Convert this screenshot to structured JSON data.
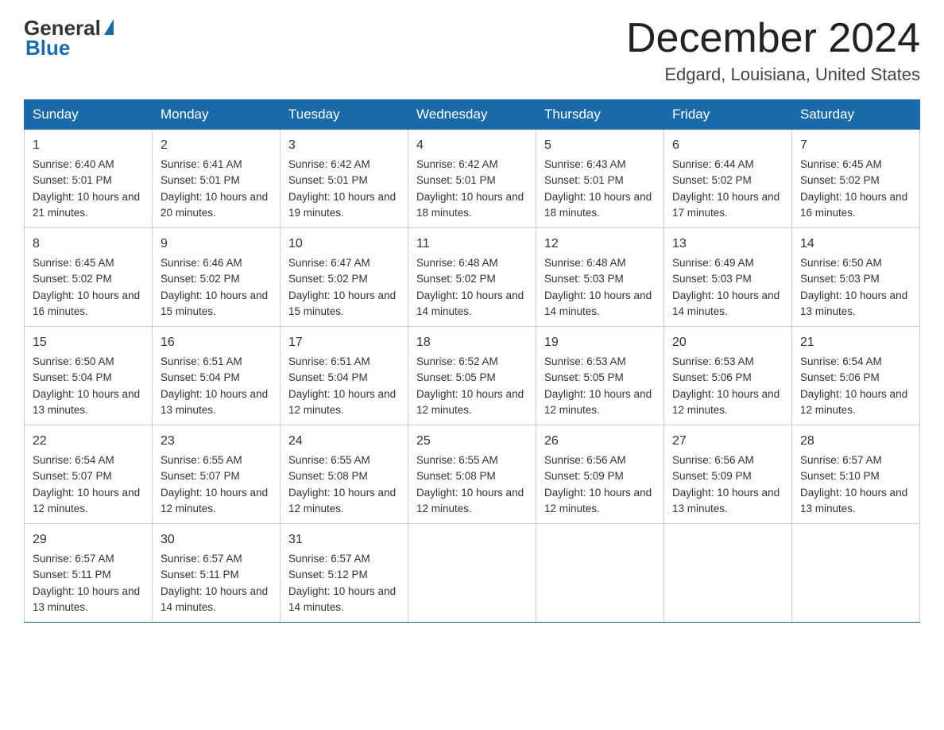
{
  "header": {
    "logo_general": "General",
    "logo_blue": "Blue",
    "month_title": "December 2024",
    "location": "Edgard, Louisiana, United States"
  },
  "days_of_week": [
    "Sunday",
    "Monday",
    "Tuesday",
    "Wednesday",
    "Thursday",
    "Friday",
    "Saturday"
  ],
  "weeks": [
    [
      {
        "day": "1",
        "sunrise": "6:40 AM",
        "sunset": "5:01 PM",
        "daylight": "10 hours and 21 minutes."
      },
      {
        "day": "2",
        "sunrise": "6:41 AM",
        "sunset": "5:01 PM",
        "daylight": "10 hours and 20 minutes."
      },
      {
        "day": "3",
        "sunrise": "6:42 AM",
        "sunset": "5:01 PM",
        "daylight": "10 hours and 19 minutes."
      },
      {
        "day": "4",
        "sunrise": "6:42 AM",
        "sunset": "5:01 PM",
        "daylight": "10 hours and 18 minutes."
      },
      {
        "day": "5",
        "sunrise": "6:43 AM",
        "sunset": "5:01 PM",
        "daylight": "10 hours and 18 minutes."
      },
      {
        "day": "6",
        "sunrise": "6:44 AM",
        "sunset": "5:02 PM",
        "daylight": "10 hours and 17 minutes."
      },
      {
        "day": "7",
        "sunrise": "6:45 AM",
        "sunset": "5:02 PM",
        "daylight": "10 hours and 16 minutes."
      }
    ],
    [
      {
        "day": "8",
        "sunrise": "6:45 AM",
        "sunset": "5:02 PM",
        "daylight": "10 hours and 16 minutes."
      },
      {
        "day": "9",
        "sunrise": "6:46 AM",
        "sunset": "5:02 PM",
        "daylight": "10 hours and 15 minutes."
      },
      {
        "day": "10",
        "sunrise": "6:47 AM",
        "sunset": "5:02 PM",
        "daylight": "10 hours and 15 minutes."
      },
      {
        "day": "11",
        "sunrise": "6:48 AM",
        "sunset": "5:02 PM",
        "daylight": "10 hours and 14 minutes."
      },
      {
        "day": "12",
        "sunrise": "6:48 AM",
        "sunset": "5:03 PM",
        "daylight": "10 hours and 14 minutes."
      },
      {
        "day": "13",
        "sunrise": "6:49 AM",
        "sunset": "5:03 PM",
        "daylight": "10 hours and 14 minutes."
      },
      {
        "day": "14",
        "sunrise": "6:50 AM",
        "sunset": "5:03 PM",
        "daylight": "10 hours and 13 minutes."
      }
    ],
    [
      {
        "day": "15",
        "sunrise": "6:50 AM",
        "sunset": "5:04 PM",
        "daylight": "10 hours and 13 minutes."
      },
      {
        "day": "16",
        "sunrise": "6:51 AM",
        "sunset": "5:04 PM",
        "daylight": "10 hours and 13 minutes."
      },
      {
        "day": "17",
        "sunrise": "6:51 AM",
        "sunset": "5:04 PM",
        "daylight": "10 hours and 12 minutes."
      },
      {
        "day": "18",
        "sunrise": "6:52 AM",
        "sunset": "5:05 PM",
        "daylight": "10 hours and 12 minutes."
      },
      {
        "day": "19",
        "sunrise": "6:53 AM",
        "sunset": "5:05 PM",
        "daylight": "10 hours and 12 minutes."
      },
      {
        "day": "20",
        "sunrise": "6:53 AM",
        "sunset": "5:06 PM",
        "daylight": "10 hours and 12 minutes."
      },
      {
        "day": "21",
        "sunrise": "6:54 AM",
        "sunset": "5:06 PM",
        "daylight": "10 hours and 12 minutes."
      }
    ],
    [
      {
        "day": "22",
        "sunrise": "6:54 AM",
        "sunset": "5:07 PM",
        "daylight": "10 hours and 12 minutes."
      },
      {
        "day": "23",
        "sunrise": "6:55 AM",
        "sunset": "5:07 PM",
        "daylight": "10 hours and 12 minutes."
      },
      {
        "day": "24",
        "sunrise": "6:55 AM",
        "sunset": "5:08 PM",
        "daylight": "10 hours and 12 minutes."
      },
      {
        "day": "25",
        "sunrise": "6:55 AM",
        "sunset": "5:08 PM",
        "daylight": "10 hours and 12 minutes."
      },
      {
        "day": "26",
        "sunrise": "6:56 AM",
        "sunset": "5:09 PM",
        "daylight": "10 hours and 12 minutes."
      },
      {
        "day": "27",
        "sunrise": "6:56 AM",
        "sunset": "5:09 PM",
        "daylight": "10 hours and 13 minutes."
      },
      {
        "day": "28",
        "sunrise": "6:57 AM",
        "sunset": "5:10 PM",
        "daylight": "10 hours and 13 minutes."
      }
    ],
    [
      {
        "day": "29",
        "sunrise": "6:57 AM",
        "sunset": "5:11 PM",
        "daylight": "10 hours and 13 minutes."
      },
      {
        "day": "30",
        "sunrise": "6:57 AM",
        "sunset": "5:11 PM",
        "daylight": "10 hours and 14 minutes."
      },
      {
        "day": "31",
        "sunrise": "6:57 AM",
        "sunset": "5:12 PM",
        "daylight": "10 hours and 14 minutes."
      },
      null,
      null,
      null,
      null
    ]
  ],
  "labels": {
    "sunrise_prefix": "Sunrise: ",
    "sunset_prefix": "Sunset: ",
    "daylight_prefix": "Daylight: "
  }
}
